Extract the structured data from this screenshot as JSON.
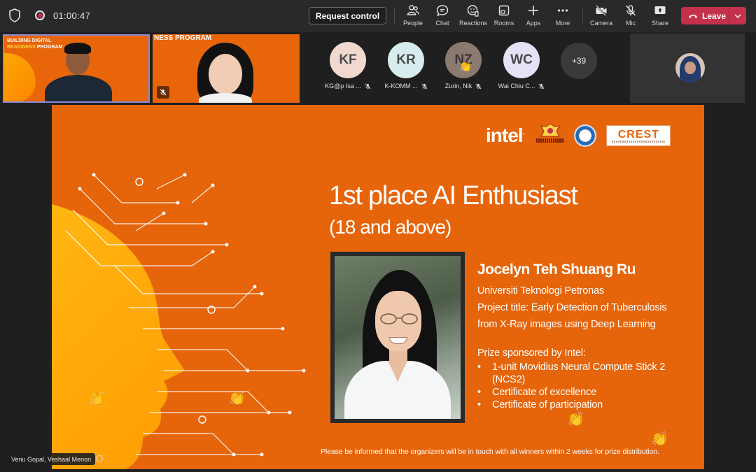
{
  "meeting": {
    "timer": "01:00:47",
    "request_control_label": "Request control"
  },
  "toolbar": [
    {
      "id": "people",
      "label": "People",
      "icon": "people-icon"
    },
    {
      "id": "chat",
      "label": "Chat",
      "icon": "chat-icon"
    },
    {
      "id": "reactions",
      "label": "Reactions",
      "icon": "reactions-icon"
    },
    {
      "id": "rooms",
      "label": "Rooms",
      "icon": "rooms-icon"
    },
    {
      "id": "apps",
      "label": "Apps",
      "icon": "plus-icon"
    },
    {
      "id": "more",
      "label": "More",
      "icon": "more-icon"
    },
    {
      "id": "camera",
      "label": "Camera",
      "icon": "camera-off-icon"
    },
    {
      "id": "mic",
      "label": "Mic",
      "icon": "mic-off-icon"
    },
    {
      "id": "share",
      "label": "Share",
      "icon": "share-icon"
    }
  ],
  "leave_label": "Leave",
  "video_tiles": {
    "tile1_banner_line1": "BUILDING DIGITAL",
    "tile1_banner_line2": "READINESS",
    "tile1_banner_line2b": "PROGRAM",
    "tile2_banner": "NESS PROGRAM"
  },
  "participants": [
    {
      "initials": "KF",
      "name": "KG@p Isa ...",
      "color": "#f1d9cf",
      "clap": false
    },
    {
      "initials": "KR",
      "name": "K-KOMM ...",
      "color": "#d7ecec",
      "clap": false
    },
    {
      "initials": "NZ",
      "name": "Zurin, Nik",
      "color": "#8a7a70",
      "clap": true
    },
    {
      "initials": "WC",
      "name": "Wai Chiu C...",
      "color": "#e4e2f4",
      "clap": false
    }
  ],
  "more_participants_label": "+39",
  "slide": {
    "logo_intel": "intel",
    "logo_crest": "CREST",
    "headline": "1st place AI Enthusiast",
    "subhead": "(18 and above)",
    "winner_name": "Jocelyn Teh Shuang Ru",
    "university": "Universiti Teknologi Petronas",
    "project_line1": "Project title: Early Detection of Tuberculosis",
    "project_line2": "from X-Ray images using Deep Learning",
    "prize_heading": "Prize sponsored by Intel:",
    "prizes": [
      "1-unit Movidius Neural Compute Stick 2",
      "(NCS2)",
      "Certificate of excellence",
      "Certificate of participation"
    ],
    "footer_note": "Please be informed that the organizers will be in touch with all winners within 2 weeks for prize distribution."
  },
  "speaker_label": "Venu Gopal, Veshaal Menon",
  "colors": {
    "slide_orange": "#e6640a",
    "leave_red": "#c4314b",
    "toolbar_bg": "#292929"
  }
}
